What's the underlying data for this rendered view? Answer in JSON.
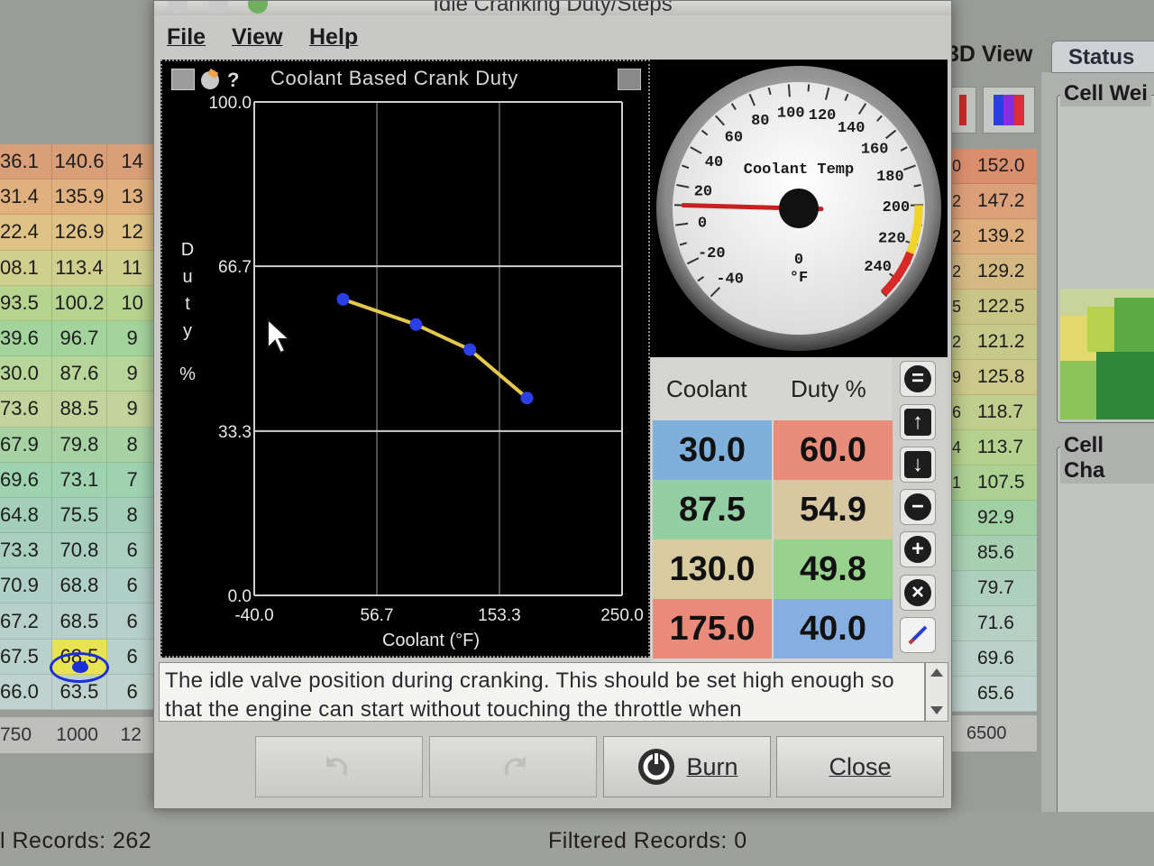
{
  "background": {
    "left_table": [
      [
        "36.1",
        "140.6",
        "14"
      ],
      [
        "31.4",
        "135.9",
        "13"
      ],
      [
        "22.4",
        "126.9",
        "12"
      ],
      [
        "08.1",
        "113.4",
        "11"
      ],
      [
        "93.5",
        "100.2",
        "10"
      ],
      [
        "39.6",
        "96.7",
        "9"
      ],
      [
        "30.0",
        "87.6",
        "9"
      ],
      [
        "73.6",
        "88.5",
        "9"
      ],
      [
        "67.9",
        "79.8",
        "8"
      ],
      [
        "69.6",
        "73.1",
        "7"
      ],
      [
        "64.8",
        "75.5",
        "8"
      ],
      [
        "73.3",
        "70.8",
        "6"
      ],
      [
        "70.9",
        "68.8",
        "6"
      ],
      [
        "67.2",
        "68.5",
        "6"
      ],
      [
        "67.5",
        "68.5",
        "6"
      ],
      [
        "66.0",
        "63.5",
        "6"
      ]
    ],
    "left_axis": [
      "750",
      "1000",
      "12"
    ],
    "right_values": [
      "152.0",
      "147.2",
      "139.2",
      "129.2",
      "122.5",
      "121.2",
      "125.8",
      "118.7",
      "113.7",
      "107.5",
      "92.9",
      "85.6",
      "79.7",
      "71.6",
      "69.6",
      "65.6"
    ],
    "right_stubs": [
      "0",
      "2",
      "2",
      "2",
      "5",
      "2",
      "9",
      "6",
      "4",
      "1",
      "",
      "",
      "",
      "",
      "",
      ""
    ],
    "right_axis": [
      "6500"
    ],
    "tab_3d": "3D View",
    "tab_status": "Status",
    "cell_weight_label": "Cell Wei",
    "cell_change_label": "Cell Cha",
    "status_records": "l Records: 262",
    "status_filtered": "Filtered Records: 0"
  },
  "dialog": {
    "title": "Idle Cranking Duty/Steps",
    "menu": [
      "File",
      "View",
      "Help"
    ],
    "panel_title": "Coolant Based Crank Duty",
    "gauge": {
      "title": "Coolant Temp",
      "unit": "°F",
      "center_label": "0",
      "scale": [
        "-40",
        "-20",
        "0",
        "20",
        "40",
        "60",
        "80",
        "100",
        "120",
        "140",
        "160",
        "180",
        "200",
        "220",
        "240"
      ],
      "value": 10,
      "min": -40,
      "max": 250
    },
    "table": {
      "headers": [
        "Coolant",
        "Duty %"
      ],
      "rows": [
        {
          "coolant": "30.0",
          "duty": "60.0"
        },
        {
          "coolant": "87.5",
          "duty": "54.9"
        },
        {
          "coolant": "130.0",
          "duty": "49.8"
        },
        {
          "coolant": "175.0",
          "duty": "40.0"
        }
      ],
      "colors": {
        "c0": "#7fb0dc",
        "d0": "#e98c7a",
        "c1": "#93cfa3",
        "d1": "#d8c8a2",
        "c2": "#d8cba0",
        "d2": "#98d28c",
        "c3": "#e98a7a",
        "d3": "#86aee0"
      }
    },
    "tools": [
      "minus-circle",
      "arrow-up",
      "arrow-down",
      "minus",
      "plus",
      "close",
      "pencil"
    ],
    "description": "The idle valve position during cranking. This should be set high enough so that the engine can start without touching the throttle when",
    "buttons": {
      "undo": "",
      "redo": "",
      "burn": "Burn",
      "close": "Close"
    }
  },
  "chart_data": {
    "type": "line",
    "title": "",
    "xlabel": "Coolant (°F)",
    "ylabel": "Duty %",
    "xlim": [
      -40.0,
      250.0
    ],
    "ylim": [
      0.0,
      100.0
    ],
    "x_ticks": [
      "-40.0",
      "56.7",
      "153.3",
      "250.0"
    ],
    "y_ticks": [
      "0.0",
      "33.3",
      "66.7",
      "100.0"
    ],
    "x": [
      30.0,
      87.5,
      130.0,
      175.0
    ],
    "y": [
      60.0,
      54.9,
      49.8,
      40.0
    ],
    "series": [
      {
        "values": [
          60.0,
          54.9,
          49.8,
          40.0
        ]
      }
    ],
    "grid": true,
    "line_color": "#e6c84a",
    "point_color": "#2a3fe8"
  }
}
